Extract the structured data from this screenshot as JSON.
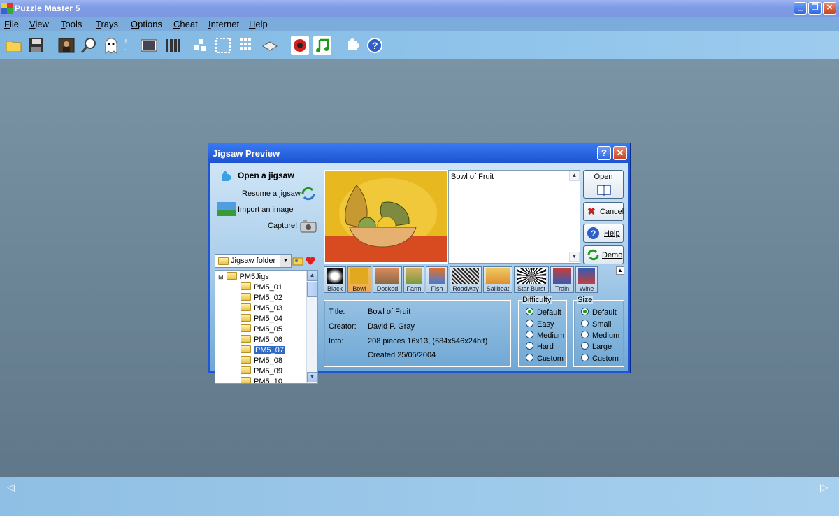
{
  "window": {
    "title": "Puzzle Master 5",
    "min_label": "_",
    "restore_label": "❐",
    "close_label": "✕"
  },
  "menu": [
    {
      "label": "File"
    },
    {
      "label": "View"
    },
    {
      "label": "Tools"
    },
    {
      "label": "Trays"
    },
    {
      "label": "Options"
    },
    {
      "label": "Cheat"
    },
    {
      "label": "Internet"
    },
    {
      "label": "Help"
    }
  ],
  "toolbar": {
    "icons": [
      "open-folder-icon",
      "save-disk-icon",
      "mona-lisa-image-icon",
      "zoom-icon",
      "ghost-icon",
      "dots-icon",
      "landscape-icon",
      "rows-icon",
      "scatter-pieces-icon",
      "select-edges-icon",
      "grid-icon",
      "tray-icon",
      "speaker-icon",
      "music-note-icon",
      "puzzle-piece-icon",
      "help-icon"
    ],
    "help_label": "?"
  },
  "statusbar": {
    "left_arrow": "◁|",
    "right_arrow": "|▷"
  },
  "dialog": {
    "title": "Jigsaw Preview",
    "help_btn": "?",
    "close_btn": "✕",
    "links": {
      "open": "Open a jigsaw",
      "resume": "Resume a jigsaw",
      "import": "Import an image",
      "capture": "Capture!"
    },
    "folder_select": {
      "value": "Jigsaw folder"
    },
    "tree": {
      "root": "PM5Jigs",
      "items": [
        "PM5_01",
        "PM5_02",
        "PM5_03",
        "PM5_04",
        "PM5_05",
        "PM5_06",
        "PM5_07",
        "PM5_08",
        "PM5_09",
        "PM5_10"
      ],
      "selected": "PM5_07"
    },
    "description": "Bowl of Fruit",
    "buttons": {
      "open": "Open",
      "cancel": "Cancel",
      "help": "Help",
      "demo": "Demo"
    },
    "thumbnails": [
      "Black",
      "Bowl",
      "Docked",
      "Farm",
      "Fish",
      "Roadway",
      "Sailboat",
      "Star Burst",
      "Train",
      "Wine"
    ],
    "selected_thumbnail": "Bowl",
    "info": {
      "title_label": "Title:",
      "title_value": "Bowl of Fruit",
      "creator_label": "Creator:",
      "creator_value": "David P. Gray",
      "info_label": "Info:",
      "info_value": "208 pieces 16x13, (684x546x24bit)",
      "created_value": "Created 25/05/2004"
    },
    "difficulty": {
      "title": "Difficulty",
      "options": [
        "Default",
        "Easy",
        "Medium",
        "Hard",
        "Custom"
      ],
      "selected": "Default"
    },
    "size": {
      "title": "Size",
      "options": [
        "Default",
        "Small",
        "Medium",
        "Large",
        "Custom"
      ],
      "selected": "Default"
    }
  }
}
